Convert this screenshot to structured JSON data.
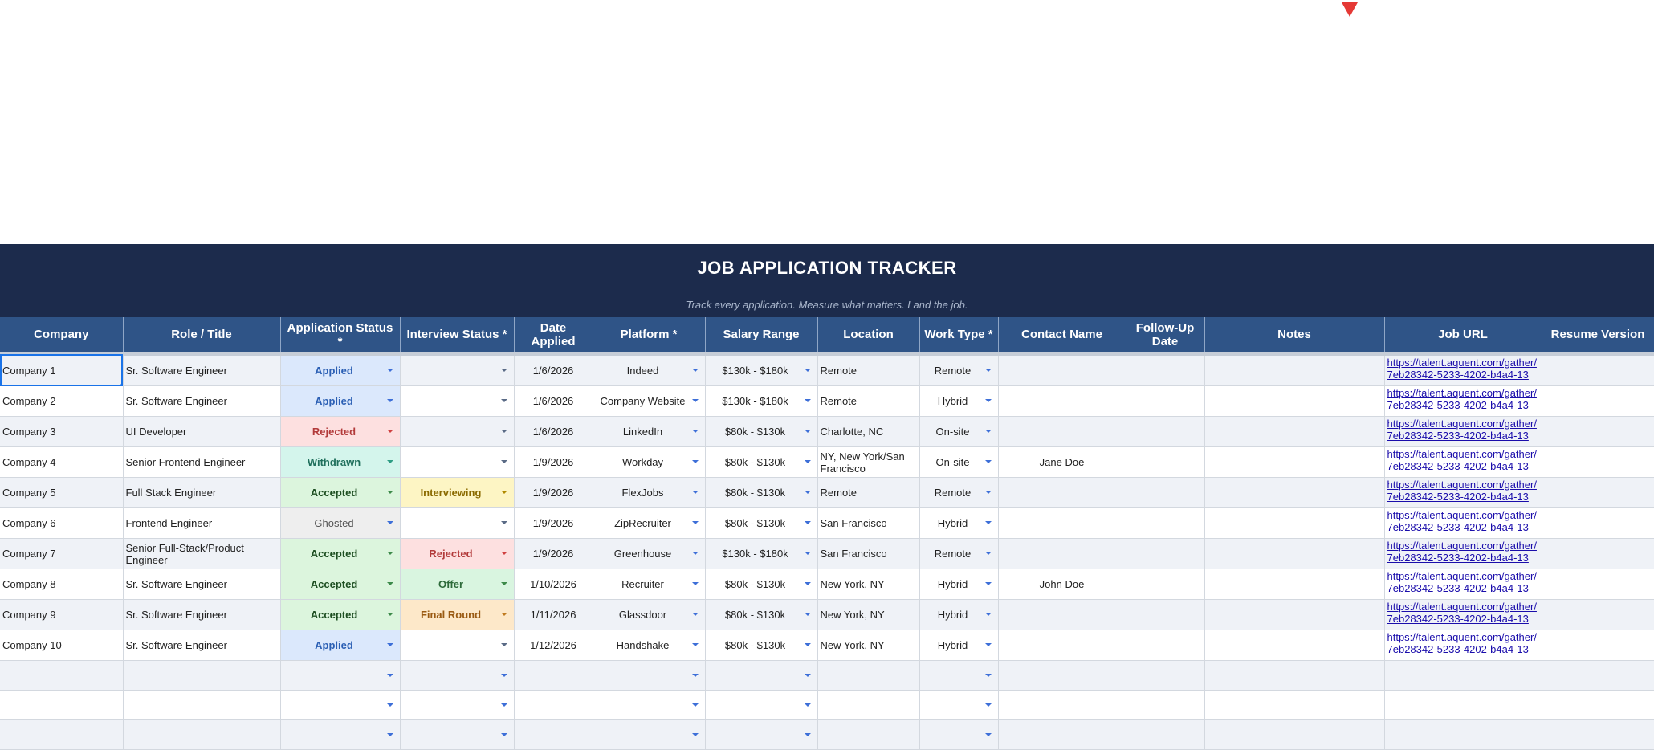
{
  "banner": {
    "title": "JOB APPLICATION TRACKER",
    "subtitle": "Track every application. Measure what matters. Land the job."
  },
  "columns": [
    "Company",
    "Role / Title",
    "Application Status *",
    "Interview Status *",
    "Date Applied",
    "Platform *",
    "Salary Range",
    "Location",
    "Work Type *",
    "Contact Name",
    "Follow-Up Date",
    "Notes",
    "Job URL",
    "Resume Version"
  ],
  "rows": [
    {
      "company": "Company 1",
      "role": "Sr. Software Engineer",
      "app_status": "Applied",
      "int_status": "",
      "date": "1/6/2026",
      "platform": "Indeed",
      "salary": "$130k - $180k",
      "location": "Remote",
      "work_type": "Remote",
      "contact": "",
      "followup": "",
      "notes": "",
      "url": "https://talent.aquent.com/gather/7eb28342-5233-4202-b4a4-13",
      "resume": ""
    },
    {
      "company": "Company 2",
      "role": "Sr. Software Engineer",
      "app_status": "Applied",
      "int_status": "",
      "date": "1/6/2026",
      "platform": "Company Website",
      "salary": "$130k - $180k",
      "location": "Remote",
      "work_type": "Hybrid",
      "contact": "",
      "followup": "",
      "notes": "",
      "url": "https://talent.aquent.com/gather/7eb28342-5233-4202-b4a4-13",
      "resume": ""
    },
    {
      "company": "Company 3",
      "role": "UI Developer",
      "app_status": "Rejected",
      "int_status": "",
      "date": "1/6/2026",
      "platform": "LinkedIn",
      "salary": "$80k - $130k",
      "location": "Charlotte, NC",
      "work_type": "On-site",
      "contact": "",
      "followup": "",
      "notes": "",
      "url": "https://talent.aquent.com/gather/7eb28342-5233-4202-b4a4-13",
      "resume": ""
    },
    {
      "company": "Company 4",
      "role": "Senior Frontend Engineer",
      "app_status": "Withdrawn",
      "int_status": "",
      "date": "1/9/2026",
      "platform": "Workday",
      "salary": "$80k - $130k",
      "location": "NY, New York/San Francisco",
      "work_type": "On-site",
      "contact": "Jane Doe",
      "followup": "",
      "notes": "",
      "url": "https://talent.aquent.com/gather/7eb28342-5233-4202-b4a4-13",
      "resume": ""
    },
    {
      "company": "Company 5",
      "role": "Full Stack Engineer",
      "app_status": "Accepted",
      "int_status": "Interviewing",
      "date": "1/9/2026",
      "platform": "FlexJobs",
      "salary": "$80k - $130k",
      "location": "Remote",
      "work_type": "Remote",
      "contact": "",
      "followup": "",
      "notes": "",
      "url": "https://talent.aquent.com/gather/7eb28342-5233-4202-b4a4-13",
      "resume": ""
    },
    {
      "company": "Company 6",
      "role": "Frontend Engineer",
      "app_status": "Ghosted",
      "int_status": "",
      "date": "1/9/2026",
      "platform": "ZipRecruiter",
      "salary": "$80k - $130k",
      "location": "San Francisco",
      "work_type": "Hybrid",
      "contact": "",
      "followup": "",
      "notes": "",
      "url": "https://talent.aquent.com/gather/7eb28342-5233-4202-b4a4-13",
      "resume": ""
    },
    {
      "company": "Company 7",
      "role": "Senior Full-Stack/Product Engineer",
      "app_status": "Accepted",
      "int_status": "Rejected",
      "date": "1/9/2026",
      "platform": "Greenhouse",
      "salary": "$130k - $180k",
      "location": "San Francisco",
      "work_type": "Remote",
      "contact": "",
      "followup": "",
      "notes": "",
      "url": "https://talent.aquent.com/gather/7eb28342-5233-4202-b4a4-13",
      "resume": ""
    },
    {
      "company": "Company 8",
      "role": "Sr. Software Engineer",
      "app_status": "Accepted",
      "int_status": "Offer",
      "date": "1/10/2026",
      "platform": "Recruiter",
      "salary": "$80k - $130k",
      "location": "New York, NY",
      "work_type": "Hybrid",
      "contact": "John Doe",
      "followup": "",
      "notes": "",
      "url": "https://talent.aquent.com/gather/7eb28342-5233-4202-b4a4-13",
      "resume": ""
    },
    {
      "company": "Company 9",
      "role": "Sr. Software Engineer",
      "app_status": "Accepted",
      "int_status": "Final Round",
      "date": "1/11/2026",
      "platform": "Glassdoor",
      "salary": "$80k - $130k",
      "location": "New York, NY",
      "work_type": "Hybrid",
      "contact": "",
      "followup": "",
      "notes": "",
      "url": "https://talent.aquent.com/gather/7eb28342-5233-4202-b4a4-13",
      "resume": ""
    },
    {
      "company": "Company 10",
      "role": "Sr. Software Engineer",
      "app_status": "Applied",
      "int_status": "",
      "date": "1/12/2026",
      "platform": "Handshake",
      "salary": "$80k - $130k",
      "location": "New York, NY",
      "work_type": "Hybrid",
      "contact": "",
      "followup": "",
      "notes": "",
      "url": "https://talent.aquent.com/gather/7eb28342-5233-4202-b4a4-13",
      "resume": ""
    }
  ],
  "empty_rows": 3,
  "colors": {
    "banner": "#1c2b4c",
    "header": "#2f5487",
    "row_alt": "#eff2f7",
    "link": "#1a0dab",
    "selection": "#1a73e8"
  }
}
